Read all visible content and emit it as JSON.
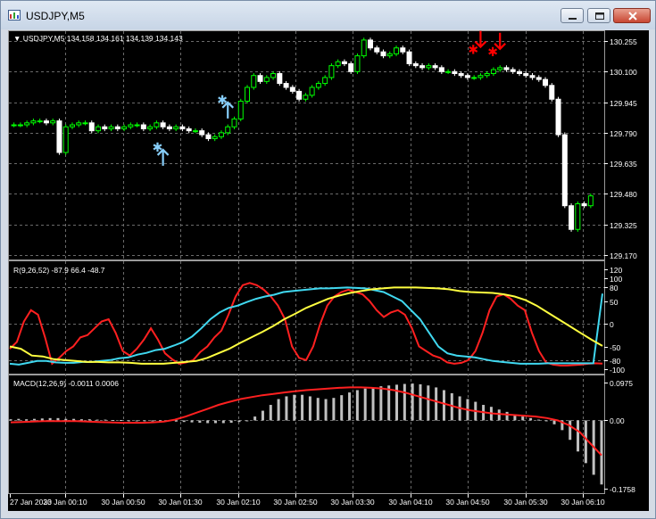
{
  "window": {
    "title": "USDJPY,M5"
  },
  "chart": {
    "header": "USDJPY,M5  134.158 134.161 134.139 134.143",
    "indicator1_header": "R(9,26,52) -87.9 66.4 -48.7",
    "indicator2_header": "MACD(12,26,9) -0.0011 0.0006",
    "colors": {
      "background": "#000000",
      "bull_candle": "#00ff00",
      "bear_candle": "#ffffff",
      "buy_signal": "#87cefa",
      "sell_signal": "#ff0000",
      "line_red": "#ff2020",
      "line_cyan": "#40d8f0",
      "line_yellow": "#ffff40",
      "macd_hist": "#c0c0c0",
      "grid": "#6a6a6a"
    }
  },
  "chart_data": [
    {
      "type": "candlestick",
      "title": "USDJPY,M5",
      "y_ticks": [
        "130.255",
        "130.100",
        "129.945",
        "129.790",
        "129.635",
        "129.480",
        "129.325",
        "129.170"
      ],
      "ylim": [
        129.17,
        130.255
      ],
      "x_ticks": [
        "27 Jan 2023",
        "30 Jan 00:10",
        "30 Jan 00:50",
        "30 Jan 01:30",
        "30 Jan 02:10",
        "30 Jan 02:50",
        "30 Jan 03:30",
        "30 Jan 04:10",
        "30 Jan 04:50",
        "30 Jan 05:30",
        "30 Jan 06:10"
      ],
      "close": [
        129.83,
        129.83,
        129.84,
        129.85,
        129.85,
        129.84,
        129.85,
        129.69,
        129.82,
        129.83,
        129.84,
        129.84,
        129.8,
        129.82,
        129.81,
        129.82,
        129.81,
        129.82,
        129.83,
        129.83,
        129.81,
        129.82,
        129.84,
        129.82,
        129.81,
        129.82,
        129.81,
        129.8,
        129.8,
        129.78,
        129.76,
        129.77,
        129.79,
        129.82,
        129.86,
        129.95,
        130.02,
        130.08,
        130.05,
        130.07,
        130.09,
        130.04,
        130.02,
        130.0,
        129.96,
        129.98,
        130.02,
        130.04,
        130.07,
        130.13,
        130.15,
        130.14,
        130.1,
        130.18,
        130.26,
        130.22,
        130.2,
        130.18,
        130.19,
        130.22,
        130.2,
        130.14,
        130.13,
        130.12,
        130.13,
        130.12,
        130.1,
        130.1,
        130.09,
        130.08,
        130.07,
        130.07,
        130.08,
        130.09,
        130.11,
        130.12,
        130.11,
        130.1,
        130.09,
        130.08,
        130.07,
        130.06,
        130.03,
        129.96,
        129.78,
        129.42,
        129.3,
        129.43,
        129.42,
        129.47
      ]
    },
    {
      "type": "line",
      "title": "R(9,26,52) -87.9 66.4 -48.7",
      "y_ticks": [
        "120",
        "100",
        "80",
        "50",
        "0",
        "-50",
        "-80",
        "-100"
      ],
      "ylim": [
        -100,
        120
      ],
      "series": [
        {
          "values": [
            -55,
            -40,
            5,
            30,
            20,
            -30,
            -88,
            -75,
            -60,
            -50,
            -30,
            -25,
            -10,
            5,
            10,
            -20,
            -60,
            -70,
            -55,
            -35,
            -10,
            -35,
            -65,
            -78,
            -88,
            -85,
            -80,
            -62,
            -50,
            -30,
            -15,
            20,
            60,
            85,
            90,
            85,
            75,
            60,
            40,
            10,
            -50,
            -75,
            -80,
            -50,
            0,
            40,
            60,
            70,
            75,
            70,
            65,
            50,
            30,
            15,
            25,
            30,
            20,
            -10,
            -50,
            -60,
            -70,
            -75,
            -85,
            -88,
            -86,
            -80,
            -60,
            -20,
            30,
            60,
            65,
            55,
            40,
            30,
            -20,
            -60,
            -85,
            -90,
            -92,
            -92,
            -91,
            -90,
            -88,
            -87,
            -87.9
          ]
        },
        {
          "values": [
            -88,
            -90,
            -86,
            -82,
            -82,
            -85,
            -86,
            -86,
            -84,
            -84,
            -82,
            -80,
            -76,
            -74,
            -68,
            -64,
            -58,
            -55,
            -48,
            -40,
            -28,
            -10,
            10,
            25,
            35,
            40,
            48,
            55,
            60,
            64,
            70,
            72,
            74,
            76,
            78,
            78,
            79,
            80,
            79,
            78,
            74,
            70,
            60,
            50,
            30,
            10,
            -20,
            -50,
            -65,
            -70,
            -72,
            -74,
            -78,
            -82,
            -84,
            -86,
            -88,
            -88,
            -88,
            -87,
            -87,
            -87,
            -87,
            -87,
            -87,
            66.4
          ]
        },
        {
          "values": [
            -50,
            -55,
            -70,
            -72,
            -78,
            -80,
            -82,
            -84,
            -84,
            -85,
            -85,
            -86,
            -88,
            -88,
            -88,
            -86,
            -84,
            -82,
            -75,
            -65,
            -55,
            -42,
            -30,
            -18,
            -5,
            10,
            22,
            35,
            45,
            55,
            62,
            68,
            72,
            76,
            78,
            80,
            80,
            80,
            79,
            78,
            76,
            72,
            70,
            69,
            68,
            65,
            60,
            52,
            40,
            25,
            10,
            -5,
            -20,
            -35,
            -48.7
          ]
        }
      ]
    },
    {
      "type": "bar",
      "title": "MACD(12,26,9) -0.0011 0.0006",
      "y_ticks": [
        "0.0975",
        "0.00",
        "-0.1758"
      ],
      "ylim": [
        -0.1758,
        0.0975
      ],
      "series": [
        {
          "values": [
            0.003,
            0.004,
            0.003,
            0.004,
            0.005,
            0.006,
            0.006,
            0.004,
            0.004,
            0.003,
            0.003,
            0.002,
            0.002,
            0.001,
            0.001,
            0.0,
            0.0,
            -0.001,
            -0.001,
            -0.002,
            -0.002,
            -0.003,
            -0.004,
            -0.005,
            -0.006,
            -0.007,
            -0.007,
            -0.007,
            -0.006,
            -0.004,
            0.0,
            0.01,
            0.025,
            0.04,
            0.055,
            0.062,
            0.066,
            0.066,
            0.062,
            0.058,
            0.055,
            0.058,
            0.065,
            0.072,
            0.078,
            0.082,
            0.085,
            0.088,
            0.09,
            0.092,
            0.094,
            0.095,
            0.093,
            0.09,
            0.085,
            0.078,
            0.07,
            0.062,
            0.055,
            0.048,
            0.04,
            0.035,
            0.028,
            0.022,
            0.016,
            0.01,
            0.006,
            0.002,
            -0.002,
            -0.01,
            -0.025,
            -0.05,
            -0.08,
            -0.11,
            -0.14,
            -0.165
          ]
        },
        {
          "values": [
            -0.005,
            -0.004,
            -0.003,
            -0.002,
            -0.002,
            -0.002,
            -0.002,
            -0.003,
            -0.004,
            -0.005,
            -0.006,
            -0.006,
            -0.006,
            -0.005,
            -0.003,
            0.002,
            0.01,
            0.02,
            0.03,
            0.04,
            0.048,
            0.055,
            0.06,
            0.065,
            0.068,
            0.072,
            0.075,
            0.078,
            0.08,
            0.082,
            0.084,
            0.085,
            0.085,
            0.084,
            0.082,
            0.078,
            0.072,
            0.064,
            0.056,
            0.048,
            0.04,
            0.032,
            0.026,
            0.022,
            0.018,
            0.016,
            0.014,
            0.012,
            0.01,
            0.006,
            0.0,
            -0.012,
            -0.03,
            -0.06,
            -0.09
          ]
        }
      ]
    }
  ],
  "signals": {
    "buy_arrows": [
      [
        23,
        129.74
      ],
      [
        33,
        129.98
      ]
    ],
    "sell_arrows": [
      [
        72,
        130.18
      ],
      [
        75,
        130.17
      ]
    ]
  }
}
